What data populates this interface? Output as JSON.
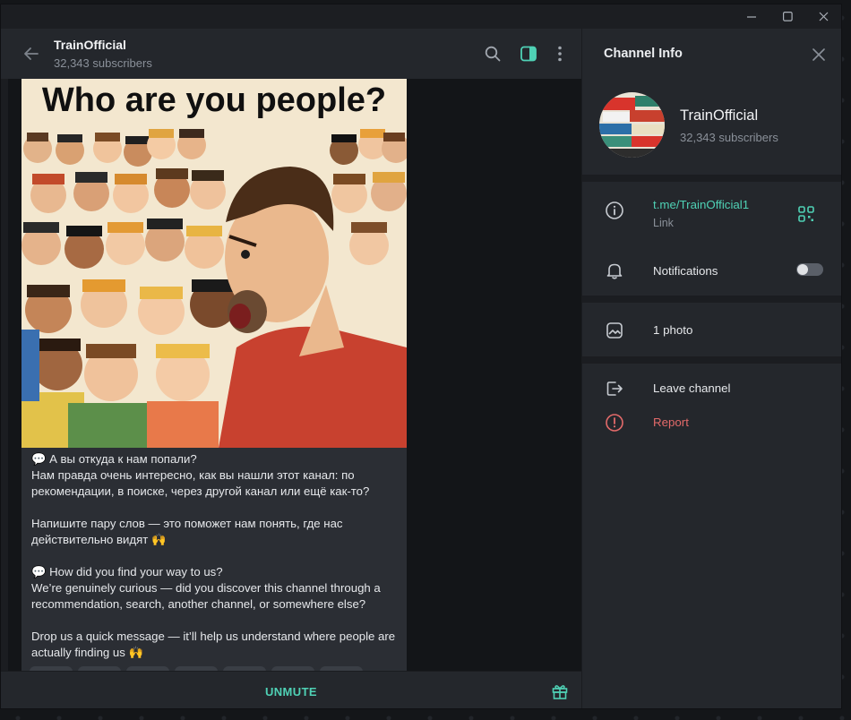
{
  "window": {
    "minimize_icon": "minimize-icon",
    "maximize_icon": "maximize-icon",
    "close_icon": "close-icon"
  },
  "chat": {
    "title": "TrainOfficial",
    "subscribers": "32,343 subscribers",
    "icons": [
      "back-arrow-icon",
      "search-icon",
      "sidebar-toggle-icon",
      "more-vertical-icon"
    ],
    "post": {
      "image_caption": "Who are you people?",
      "text": "💬 А вы откуда к нам попали?\nНам правда очень интересно, как вы нашли этот канал: по рекомендации, в поиске, через другой канал или ещё как-то?\n\nНапишите пару слов — это поможет нам понять, где нас действительно видят 🙌\n\n💬 How did you find your way to us?\nWe’re genuinely curious — did you discover this channel through a recommendation, search, another channel, or somewhere else?\n\nDrop us a quick message — it’ll help us understand where people are actually finding us 🙌"
    },
    "footer": {
      "unmute_label": "UNMUTE",
      "gift_icon": "gift-icon"
    }
  },
  "info": {
    "header_title": "Channel Info",
    "name": "TrainOfficial",
    "subscribers": "32,343 subscribers",
    "link": "t.me/TrainOfficial1",
    "link_caption": "Link",
    "notifications_label": "Notifications",
    "notifications_enabled": false,
    "photos_label": "1 photo",
    "leave_label": "Leave channel",
    "report_label": "Report",
    "colors": {
      "accent": "#4fd1b5",
      "danger": "#e36a6a",
      "panel": "#24272c"
    }
  }
}
